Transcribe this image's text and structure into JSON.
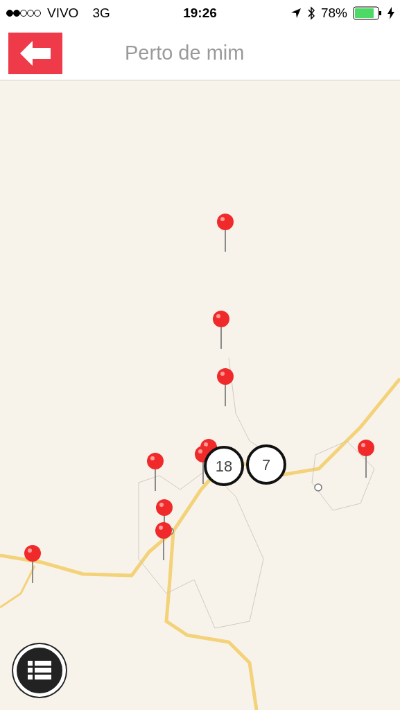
{
  "status_bar": {
    "carrier": "VIVO",
    "network": "3G",
    "time": "19:26",
    "battery": "78%"
  },
  "header": {
    "title": "Perto de mim"
  },
  "map": {
    "clusters": [
      {
        "count": "18"
      },
      {
        "count": "7"
      }
    ]
  }
}
